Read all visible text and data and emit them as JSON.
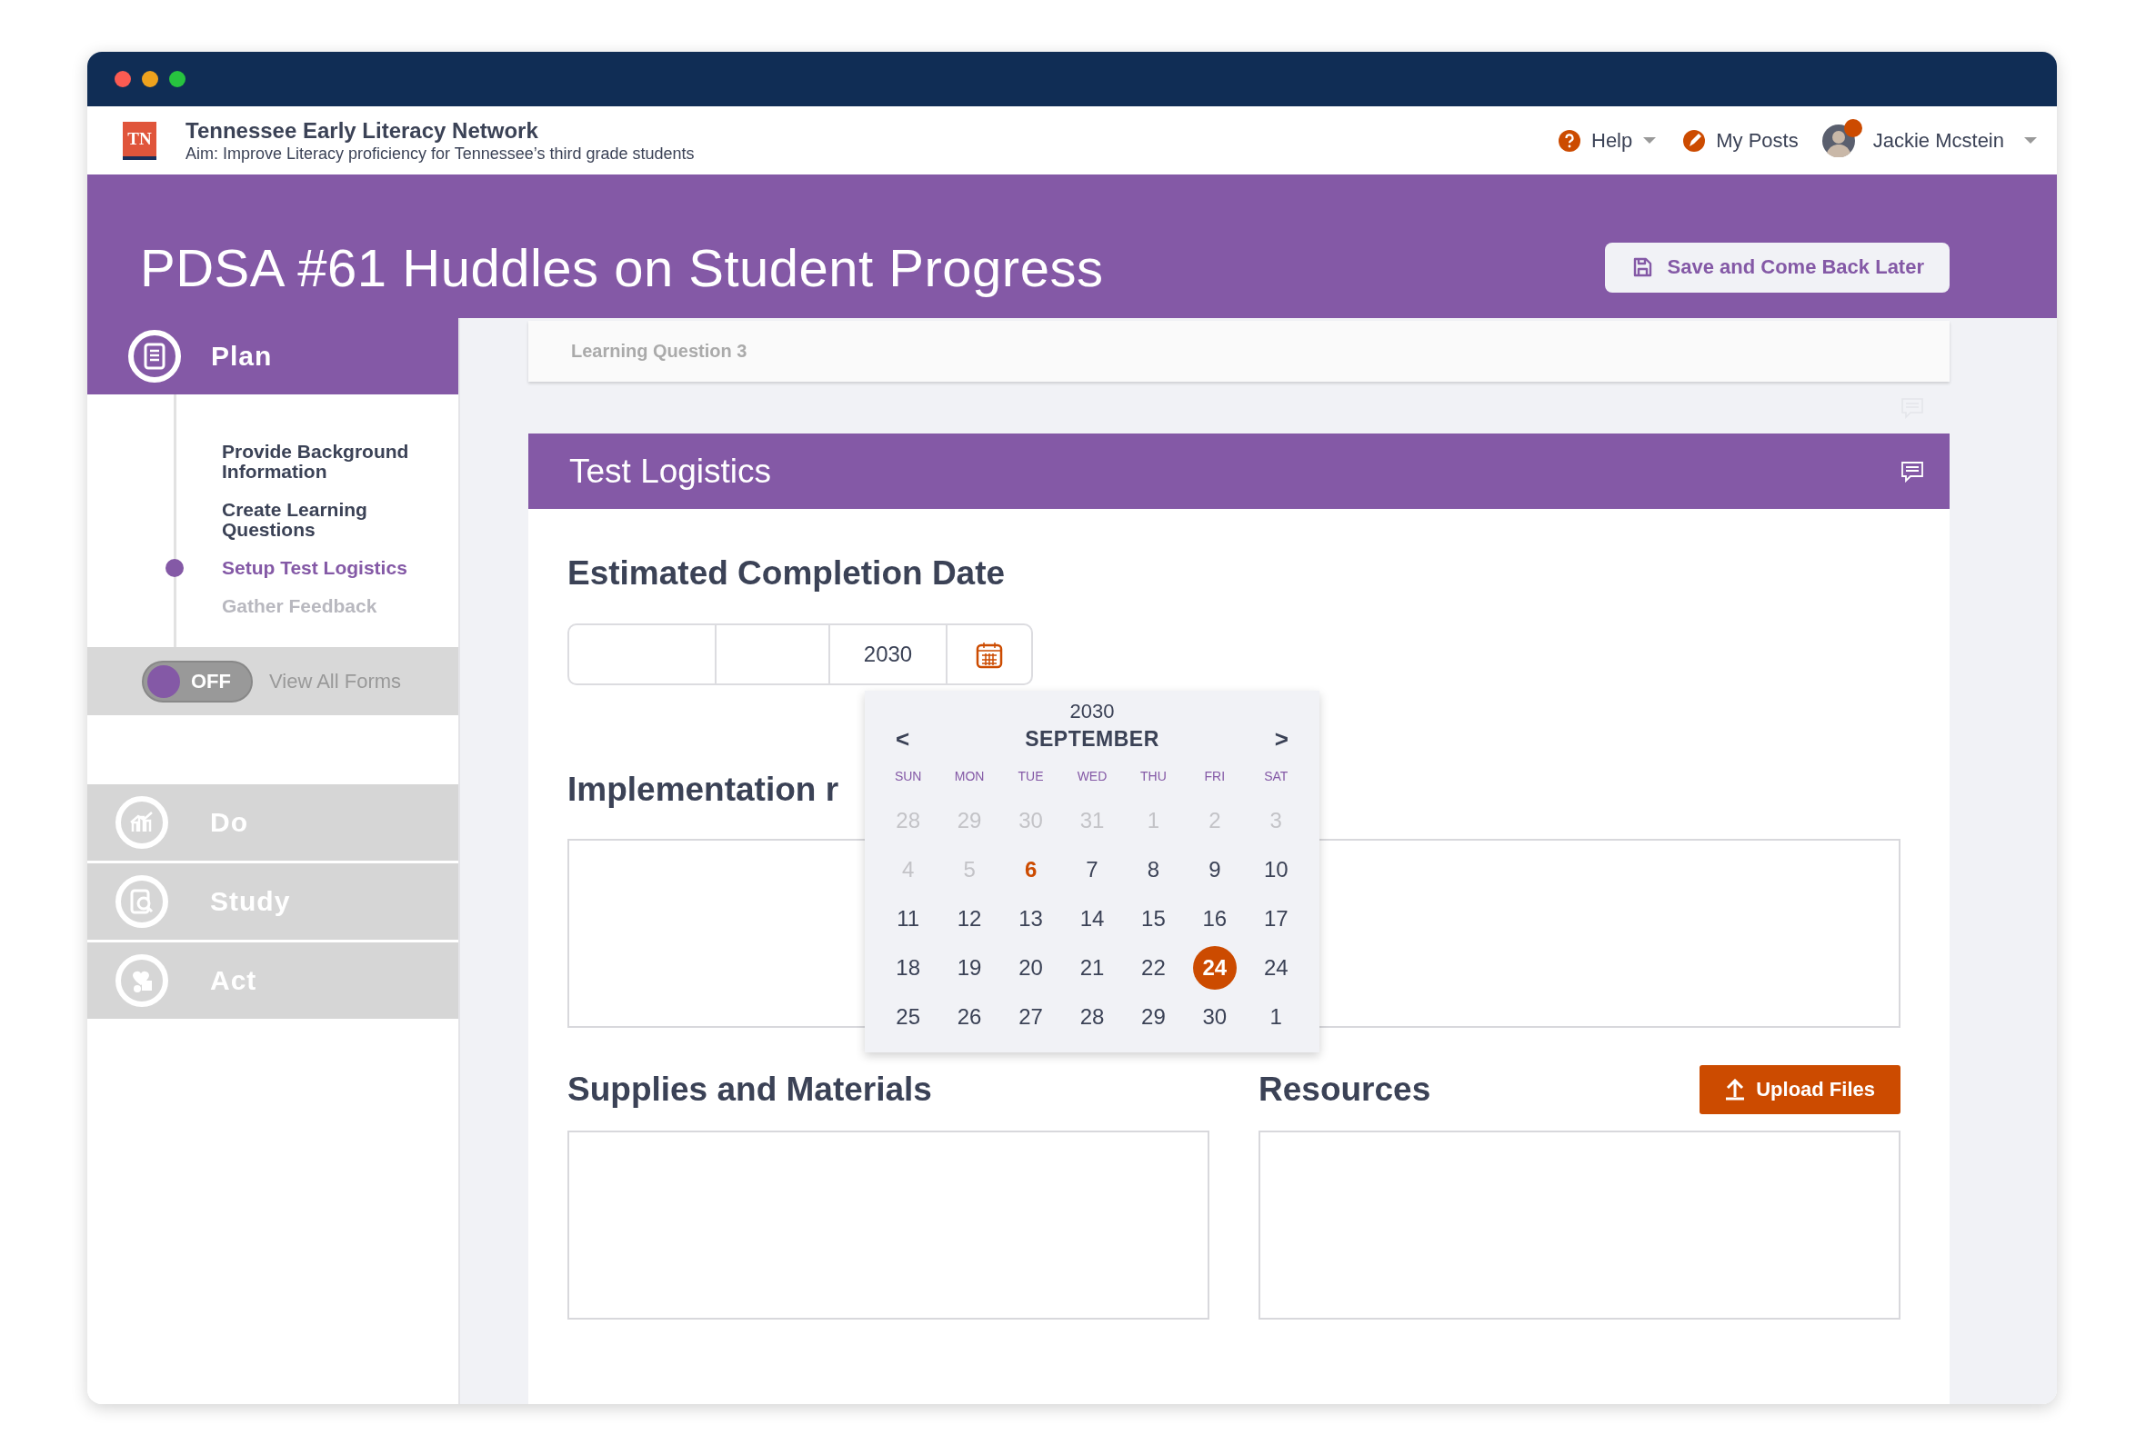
{
  "header": {
    "logo": "TN",
    "org_name": "Tennessee Early Literacy Network",
    "aim": "Aim: Improve Literacy proficiency for Tennessee’s third grade students",
    "nav": [
      {
        "kind": "help",
        "label": "Help",
        "dropdown": true
      },
      {
        "kind": "posts",
        "label": "My Posts",
        "dropdown": false
      }
    ],
    "user": {
      "name": "Jackie Mcstein",
      "notification": true
    }
  },
  "banner": {
    "title": "PDSA #61 Huddles on Student Progress",
    "save_button": "Save and Come Back Later"
  },
  "sidebar": {
    "phases": [
      {
        "kind": "plan",
        "label": "Plan",
        "selected": true,
        "steps": [
          {
            "label": "Provide Background Information",
            "selected": false,
            "disabled": false
          },
          {
            "label": "Create Learning Questions",
            "selected": false,
            "disabled": false
          },
          {
            "label": "Setup Test Logistics",
            "selected": true,
            "disabled": false
          },
          {
            "label": "Gather Feedback",
            "selected": false,
            "disabled": true
          }
        ]
      },
      {
        "kind": "do",
        "label": "Do",
        "selected": false
      },
      {
        "kind": "study",
        "label": "Study",
        "selected": false
      },
      {
        "kind": "act",
        "label": "Act",
        "selected": false
      }
    ],
    "toggle": {
      "label": "OFF",
      "on": false,
      "caption": "View All Forms"
    }
  },
  "breadcrumb": "Learning Question 3",
  "section": {
    "title": "Test Logistics",
    "date": {
      "heading": "Estimated Completion Date",
      "year": "2030"
    },
    "calendar": {
      "year": "2030",
      "month": "SEPTEMBER",
      "prev": "<",
      "next": ">",
      "weekdays": [
        "SUN",
        "MON",
        "TUE",
        "WED",
        "THU",
        "FRI",
        "SAT"
      ],
      "weeks": [
        [
          {
            "day": "28",
            "outside": true,
            "today": false,
            "selected": false
          },
          {
            "day": "29",
            "outside": true,
            "today": false,
            "selected": false
          },
          {
            "day": "30",
            "outside": true,
            "today": false,
            "selected": false
          },
          {
            "day": "31",
            "outside": true,
            "today": false,
            "selected": false
          },
          {
            "day": "1",
            "outside": true,
            "today": false,
            "selected": false
          },
          {
            "day": "2",
            "outside": true,
            "today": false,
            "selected": false
          },
          {
            "day": "3",
            "outside": true,
            "today": false,
            "selected": false
          }
        ],
        [
          {
            "day": "4",
            "outside": true,
            "today": false,
            "selected": false
          },
          {
            "day": "5",
            "outside": true,
            "today": false,
            "selected": false
          },
          {
            "day": "6",
            "outside": false,
            "today": true,
            "selected": false
          },
          {
            "day": "7",
            "outside": false,
            "today": false,
            "selected": false
          },
          {
            "day": "8",
            "outside": false,
            "today": false,
            "selected": false
          },
          {
            "day": "9",
            "outside": false,
            "today": false,
            "selected": false
          },
          {
            "day": "10",
            "outside": false,
            "today": false,
            "selected": false
          }
        ],
        [
          {
            "day": "11",
            "outside": false,
            "today": false,
            "selected": false
          },
          {
            "day": "12",
            "outside": false,
            "today": false,
            "selected": false
          },
          {
            "day": "13",
            "outside": false,
            "today": false,
            "selected": false
          },
          {
            "day": "14",
            "outside": false,
            "today": false,
            "selected": false
          },
          {
            "day": "15",
            "outside": false,
            "today": false,
            "selected": false
          },
          {
            "day": "16",
            "outside": false,
            "today": false,
            "selected": false
          },
          {
            "day": "17",
            "outside": false,
            "today": false,
            "selected": false
          }
        ],
        [
          {
            "day": "18",
            "outside": false,
            "today": false,
            "selected": false
          },
          {
            "day": "19",
            "outside": false,
            "today": false,
            "selected": false
          },
          {
            "day": "20",
            "outside": false,
            "today": false,
            "selected": false
          },
          {
            "day": "21",
            "outside": false,
            "today": false,
            "selected": false
          },
          {
            "day": "22",
            "outside": false,
            "today": false,
            "selected": false
          },
          {
            "day": "24",
            "outside": false,
            "today": false,
            "selected": true
          },
          {
            "day": "24",
            "outside": false,
            "today": false,
            "selected": false
          }
        ],
        [
          {
            "day": "25",
            "outside": false,
            "today": false,
            "selected": false
          },
          {
            "day": "26",
            "outside": false,
            "today": false,
            "selected": false
          },
          {
            "day": "27",
            "outside": false,
            "today": false,
            "selected": false
          },
          {
            "day": "28",
            "outside": false,
            "today": false,
            "selected": false
          },
          {
            "day": "29",
            "outside": false,
            "today": false,
            "selected": false
          },
          {
            "day": "30",
            "outside": false,
            "today": false,
            "selected": false
          },
          {
            "day": "1",
            "outside": false,
            "today": false,
            "selected": false
          }
        ]
      ]
    },
    "implementation": {
      "heading": "Implementation r"
    },
    "supplies": {
      "heading": "Supplies and Materials"
    },
    "resources": {
      "heading": "Resources",
      "upload_button": "Upload Files"
    }
  }
}
